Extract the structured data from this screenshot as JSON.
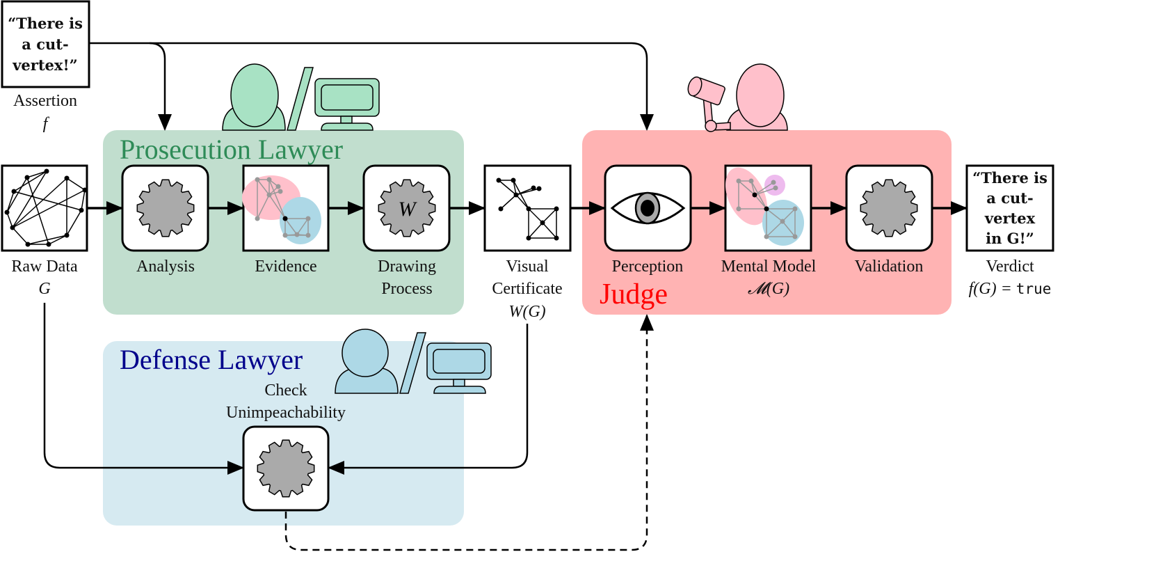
{
  "assertion": {
    "quote_lines": [
      "“There is",
      "a cut-",
      "vertex!”"
    ],
    "label": "Assertion",
    "symbol": "f"
  },
  "raw_data": {
    "label": "Raw Data",
    "symbol": "G"
  },
  "prosecution": {
    "title": "Prosecution Lawyer",
    "color": "#2e8b57",
    "fill": "#c1dece",
    "actor_color": "#a8e2c4",
    "steps": [
      {
        "label": "Analysis"
      },
      {
        "label": "Evidence"
      },
      {
        "label_lines": [
          "Drawing",
          "Process"
        ],
        "gear_letter": "W"
      }
    ]
  },
  "certificate": {
    "label_lines": [
      "Visual",
      "Certificate"
    ],
    "symbol": "W(G)"
  },
  "judge": {
    "title": "Judge",
    "color": "#ff0000",
    "fill": "#ffb3b3",
    "actor_color": "#ffc0cb",
    "steps": [
      {
        "label": "Perception",
        "icon": "eye-icon"
      },
      {
        "label": "Mental Model",
        "symbol": "𝓜(G)"
      },
      {
        "label": "Validation"
      }
    ]
  },
  "verdict": {
    "quote_lines": [
      "“There is",
      "a cut-",
      "vertex",
      "in G!”"
    ],
    "label": "Verdict",
    "formula": "f(G) = ",
    "value": "true"
  },
  "defense": {
    "title": "Defense Lawyer",
    "color": "#00008b",
    "fill": "#d6eaf1",
    "actor_color": "#add8e6",
    "step_lines": [
      "Check",
      "Unimpeachability"
    ]
  },
  "colors": {
    "gear": "#aaaaaa",
    "cluster_pink": "#ffc0cb",
    "cluster_blue": "#add8e6",
    "cluster_violet": "#eebbee"
  }
}
